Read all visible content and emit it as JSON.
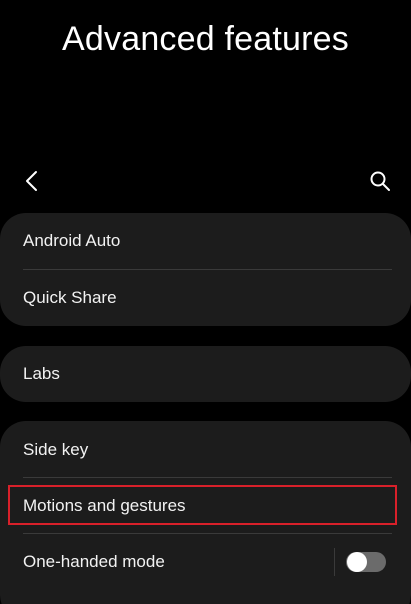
{
  "header": {
    "title": "Advanced features"
  },
  "toolbar": {
    "back_icon": "chevron-left-icon",
    "search_icon": "search-icon"
  },
  "groups": [
    {
      "items": [
        {
          "label": "Android Auto"
        },
        {
          "label": "Quick Share"
        }
      ]
    },
    {
      "items": [
        {
          "label": "Labs"
        }
      ]
    },
    {
      "items": [
        {
          "label": "Side key"
        },
        {
          "label": "Motions and gestures",
          "highlighted": true
        },
        {
          "label": "One-handed mode",
          "toggle": {
            "on": false
          }
        }
      ]
    }
  ],
  "colors": {
    "background": "#000000",
    "card": "#1c1c1c",
    "divider": "#3a3a3a",
    "highlight_border": "#d8202a",
    "toggle_track_off": "#6b6b6b",
    "toggle_knob": "#ffffff"
  }
}
